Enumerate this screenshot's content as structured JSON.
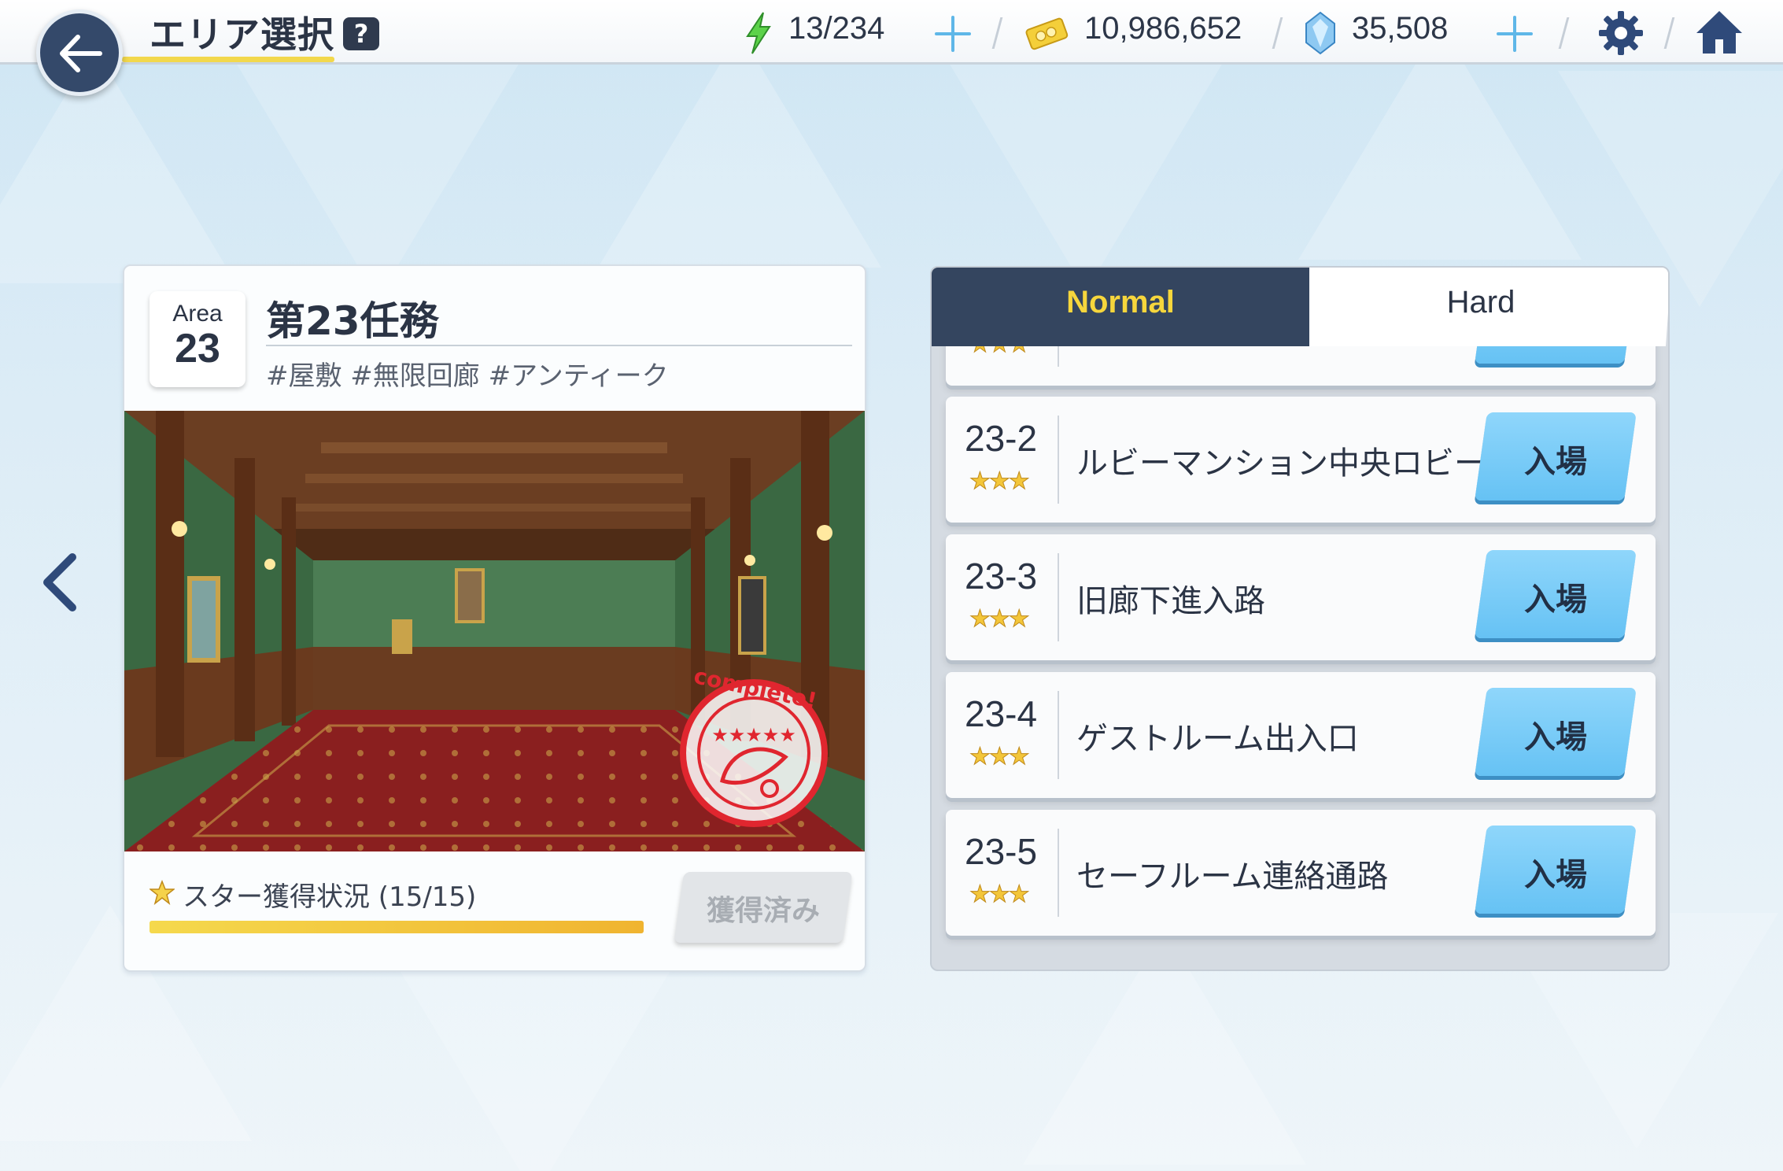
{
  "header": {
    "title": "エリア選択",
    "help": "?",
    "stamina": "13/234",
    "coins": "10,986,652",
    "gems": "35,508"
  },
  "area": {
    "badge_word": "Area",
    "badge_number": "23",
    "name": "第23任務",
    "tags": "#屋敷 #無限回廊 #アンティーク",
    "stamp_text": "complete!",
    "star_status": "スター獲得状況 (15/15)",
    "star_progress": 1.0,
    "claimed_label": "獲得済み"
  },
  "tabs": {
    "normal": "Normal",
    "hard": "Hard",
    "active": "Normal"
  },
  "quests": [
    {
      "id": "",
      "stars": 3,
      "name": "",
      "enter": ""
    },
    {
      "id": "23-2",
      "stars": 3,
      "name": "ルビーマンション中央ロビー",
      "enter": "入場"
    },
    {
      "id": "23-3",
      "stars": 3,
      "name": "旧廊下進入路",
      "enter": "入場"
    },
    {
      "id": "23-4",
      "stars": 3,
      "name": "ゲストルーム出入口",
      "enter": "入場"
    },
    {
      "id": "23-5",
      "stars": 3,
      "name": "セーフルーム連絡通路",
      "enter": "入場"
    }
  ],
  "colors": {
    "navy": "#34455f",
    "accent_yellow": "#f6d63c",
    "enter_blue": "#66c2f4"
  }
}
